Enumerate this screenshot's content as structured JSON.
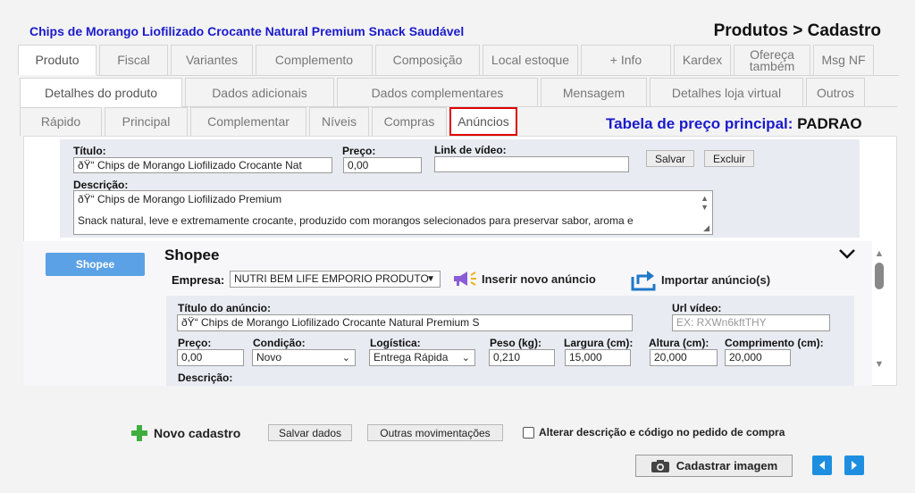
{
  "header": {
    "product_title": "Chips de Morango Liofilizado Crocante Natural Premium Snack Saudável",
    "breadcrumb": "Produtos > Cadastro"
  },
  "tabs_main": [
    "Produto",
    "Fiscal",
    "Variantes",
    "Complemento",
    "Composição",
    "Local estoque",
    "+ Info",
    "Kardex",
    "Ofereça também",
    "Msg NF"
  ],
  "tabs_sub": [
    "Detalhes do produto",
    "Dados adicionais",
    "Dados complementares",
    "Mensagem",
    "Detalhes loja virtual",
    "Outros"
  ],
  "tabs_detail": [
    "Rápido",
    "Principal",
    "Complementar",
    "Níveis",
    "Compras",
    "Anúncios"
  ],
  "price_table": {
    "label": "Tabela de preço principal:",
    "value": "PADRAO"
  },
  "form": {
    "titulo_label": "Título:",
    "titulo_value": "ðŸ“ Chips de Morango Liofilizado Crocante Nat",
    "preco_label": "Preço:",
    "preco_value": "0,00",
    "video_label": "Link de vídeo:",
    "video_value": "",
    "salvar": "Salvar",
    "excluir": "Excluir",
    "descricao_label": "Descrição:",
    "descricao_line1": "ðŸ“ Chips de Morango Liofilizado Premium",
    "descricao_line2": "Snack natural, leve e extremamente crocante, produzido com morangos selecionados para preservar sabor, aroma e"
  },
  "marketplace": {
    "button": "Shopee",
    "title": "Shopee",
    "empresa_label": "Empresa:",
    "empresa_value": "NUTRI BEM LIFE EMPORIO PRODUTO",
    "inserir": "Inserir novo anúncio",
    "importar": "Importar anúncio(s)",
    "ad_title_label": "Título do anúncio:",
    "ad_title_value": "ðŸ“ Chips de Morango Liofilizado Crocante Natural Premium S",
    "url_label": "Url vídeo:",
    "url_placeholder": "EX: RXWn6kftTHY",
    "preco_label": "Preço:",
    "preco_value": "0,00",
    "condicao_label": "Condição:",
    "condicao_value": "Novo",
    "logistica_label": "Logística:",
    "logistica_value": "Entrega Rápida",
    "peso_label": "Peso (kg):",
    "peso_value": "0,210",
    "largura_label": "Largura (cm):",
    "largura_value": "15,000",
    "altura_label": "Altura (cm):",
    "altura_value": "20,000",
    "comprimento_label": "Comprimento (cm):",
    "comprimento_value": "20,000",
    "descricao_label": "Descrição:"
  },
  "footer": {
    "novo": "Novo cadastro",
    "salvar": "Salvar dados",
    "outras": "Outras movimentações",
    "alterar": "Alterar descrição e código no pedido de compra",
    "cadastrar_imagem": "Cadastrar imagem"
  },
  "colors": {
    "accent_blue": "#1a1acc",
    "shopee_button": "#5ba1e6",
    "highlight": "#e00000",
    "nav_blue": "#1e8fe0"
  },
  "icons": [
    "chevron-down-icon",
    "megaphone-icon",
    "import-icon",
    "plus-icon",
    "camera-icon",
    "arrow-left-icon",
    "arrow-right-icon"
  ]
}
